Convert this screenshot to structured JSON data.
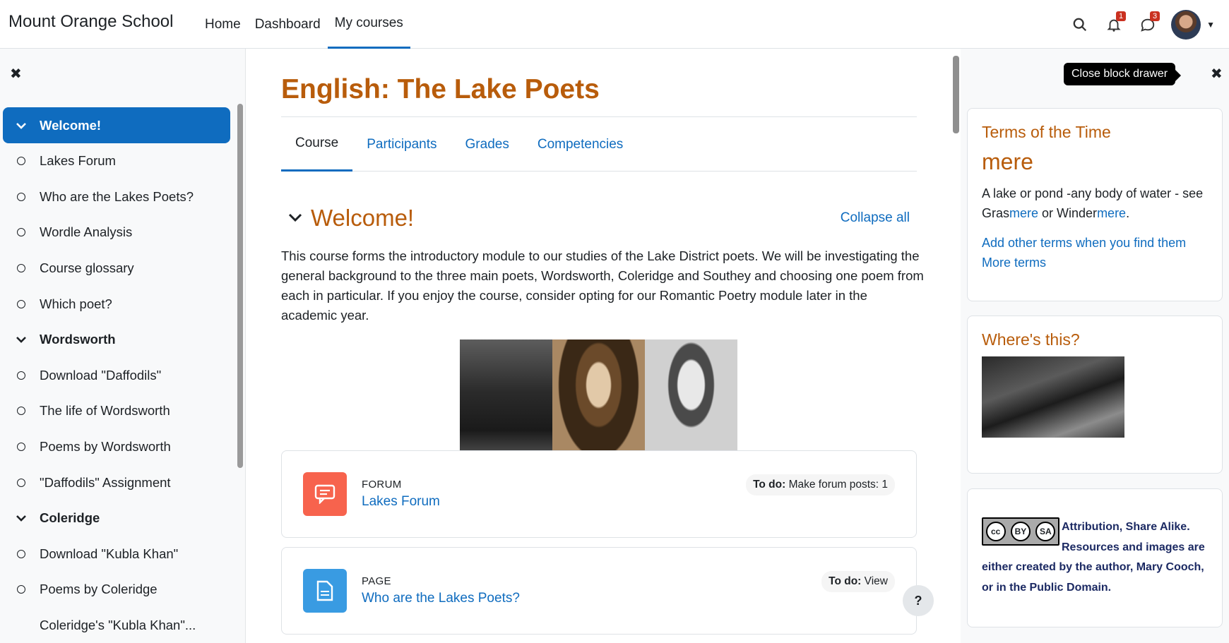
{
  "navbar": {
    "brand": "Mount Orange School",
    "links": [
      "Home",
      "Dashboard",
      "My courses"
    ],
    "active_link": "My courses",
    "notifications_count": "1",
    "messages_count": "3"
  },
  "course_index": {
    "items": [
      {
        "label": "Welcome!",
        "type": "section",
        "active": true
      },
      {
        "label": "Lakes Forum",
        "type": "activity"
      },
      {
        "label": "Who are the Lakes Poets?",
        "type": "activity"
      },
      {
        "label": "Wordle Analysis",
        "type": "activity"
      },
      {
        "label": "Course glossary",
        "type": "activity"
      },
      {
        "label": "Which poet?",
        "type": "activity"
      },
      {
        "label": "Wordsworth",
        "type": "section"
      },
      {
        "label": "Download \"Daffodils\"",
        "type": "activity"
      },
      {
        "label": "The life of Wordsworth",
        "type": "activity"
      },
      {
        "label": "Poems by Wordsworth",
        "type": "activity"
      },
      {
        "label": "\"Daffodils\" Assignment",
        "type": "activity"
      },
      {
        "label": "Coleridge",
        "type": "section"
      },
      {
        "label": "Download \"Kubla Khan\"",
        "type": "activity"
      },
      {
        "label": "Poems by Coleridge",
        "type": "activity"
      },
      {
        "label": "Coleridge's \"Kubla Khan\"...",
        "type": "activity_noicon"
      }
    ]
  },
  "main": {
    "title": "English: The Lake Poets",
    "tabs": [
      "Course",
      "Participants",
      "Grades",
      "Competencies"
    ],
    "section_title": "Welcome!",
    "collapse_all": "Collapse all",
    "summary": "This course forms the introductory module to our studies of the Lake District poets. We will be investigating the  general background to the three main poets, Wordsworth, Coleridge and Southey and choosing one poem from each in particular. If you enjoy the course, consider opting for our Romantic Poetry module later in the academic year.",
    "activities": [
      {
        "type": "FORUM",
        "name": "Lakes Forum",
        "todo_label": "To do:",
        "todo_value": "Make forum posts: 1",
        "color": "#f7634d"
      },
      {
        "type": "PAGE",
        "name": "Who are the Lakes Poets?",
        "todo_label": "To do:",
        "todo_value": "View",
        "color": "#399be2"
      }
    ],
    "help": "?"
  },
  "right_drawer": {
    "tooltip": "Close block drawer",
    "terms_block": {
      "title": "Terms of the Time",
      "word": "mere",
      "def_a": "A lake or pond -any body of water - see Gras",
      "def_link1": "mere",
      "def_b": " or Winder",
      "def_link2": "mere",
      "def_c": ".",
      "link_add": "Add other terms when you find them",
      "link_more": "More terms"
    },
    "where_block": {
      "title": "Where's this?"
    },
    "license_block": {
      "text": "Attribution, Share Alike. Resources and images are either created by the author, Mary Cooch, or in the Public Domain.",
      "badge_cc": "cc",
      "badge_by": "BY",
      "badge_sa": "SA"
    }
  },
  "colors": {
    "accent": "#0f6cbf",
    "heading": "#b85c0b"
  }
}
